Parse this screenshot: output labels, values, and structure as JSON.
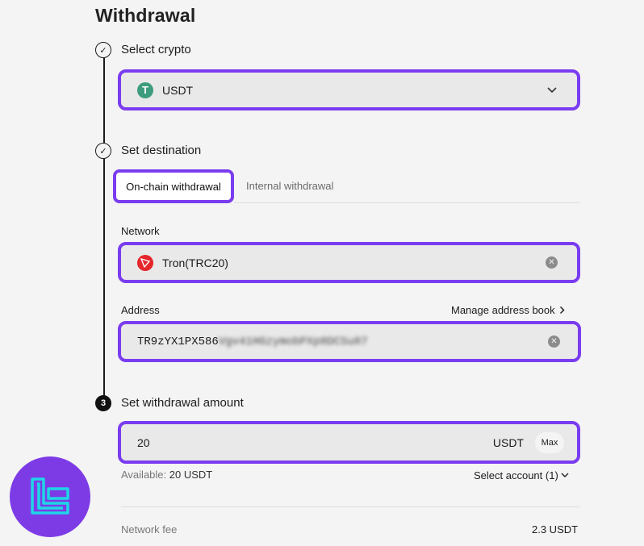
{
  "page": {
    "title": "Withdrawal"
  },
  "steps": {
    "select_crypto": {
      "label": "Select crypto",
      "marker": "✓"
    },
    "set_destination": {
      "label": "Set destination",
      "marker": "✓"
    },
    "set_amount": {
      "label": "Set withdrawal amount",
      "marker": "3"
    }
  },
  "crypto_select": {
    "coin_symbol": "T",
    "value": "USDT",
    "coin_color": "#3d9c7e"
  },
  "destination_tabs": [
    {
      "label": "On-chain withdrawal",
      "active": true
    },
    {
      "label": "Internal withdrawal",
      "active": false
    }
  ],
  "network": {
    "label": "Network",
    "value": "Tron(TRC20)",
    "coin_color": "#e5262b"
  },
  "address": {
    "label": "Address",
    "manage_link": "Manage address book",
    "value_visible": "TR9zYX1PX586",
    "value_blurred": "Vgv41HGzymobPXp8DCSu87"
  },
  "amount": {
    "value": "20",
    "unit": "USDT",
    "max_label": "Max",
    "available_label": "Available:",
    "available_value": "20 USDT",
    "select_account": "Select account (1)"
  },
  "fee": {
    "label": "Network fee",
    "value": "2.3 USDT"
  },
  "colors": {
    "highlight": "#7a3cf0",
    "logo_bg": "#7d3be6",
    "logo_accent": "#1fd6e6"
  },
  "icons": {
    "chevron": "chevron-down-icon",
    "clear": "clear-icon",
    "check": "check-icon",
    "tether": "tether-icon",
    "tron": "tron-icon",
    "logo": "brand-logo"
  }
}
